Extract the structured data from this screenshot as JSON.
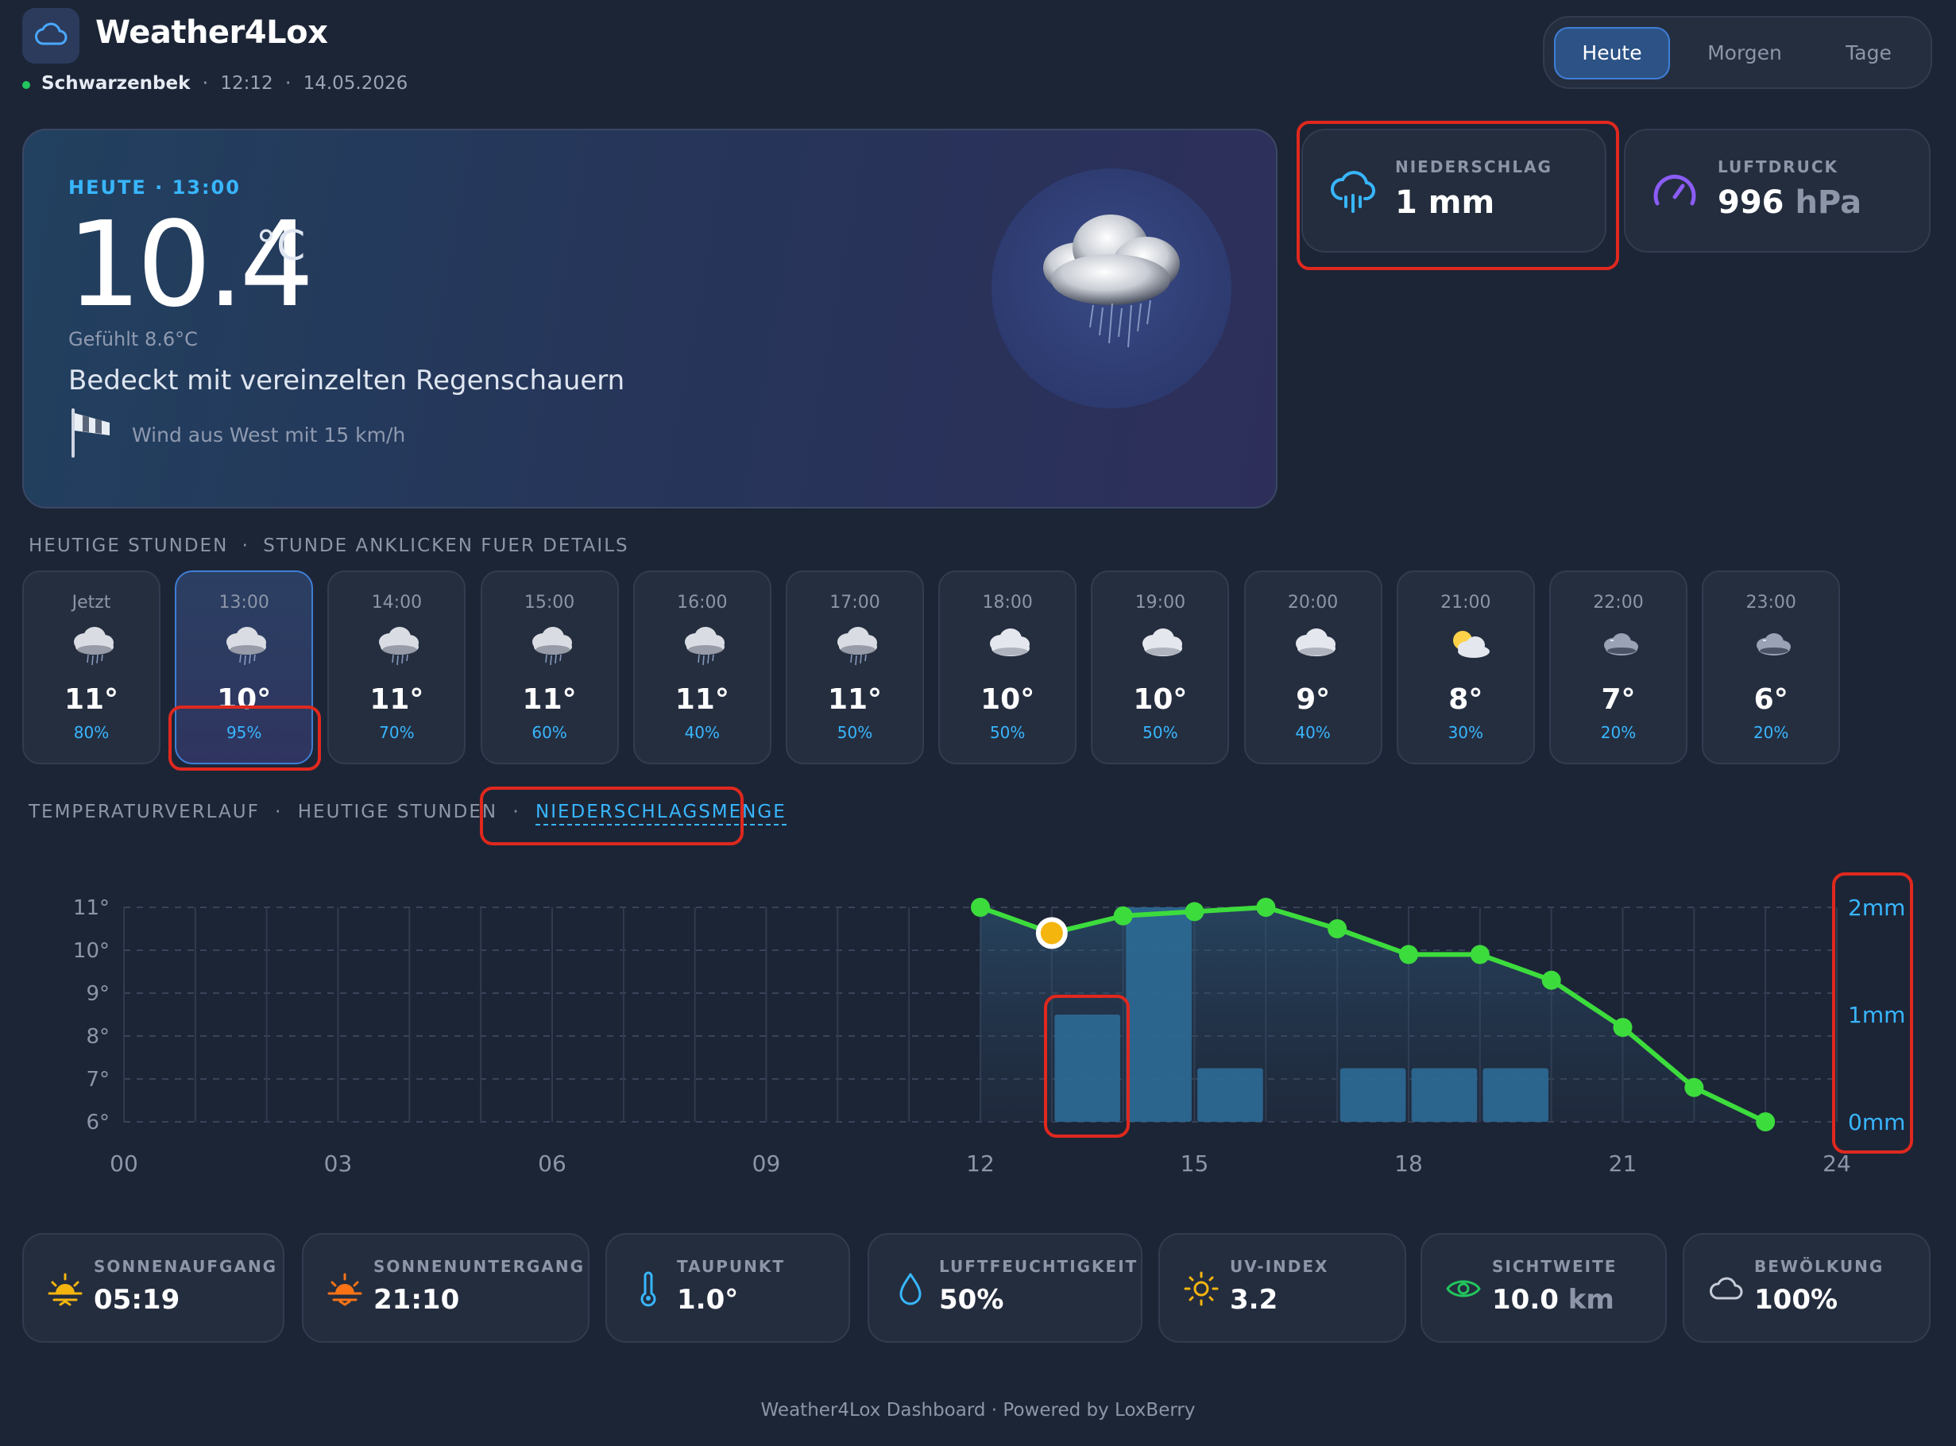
{
  "app": {
    "title": "Weather4Lox",
    "location": "Schwarzenbek",
    "time": "12:12",
    "date": "14.05.2026",
    "separator": "·"
  },
  "tabs": [
    {
      "label": "Heute",
      "active": true
    },
    {
      "label": "Morgen",
      "active": false
    },
    {
      "label": "Tage",
      "active": false
    }
  ],
  "hero": {
    "label": "HEUTE · 13:00",
    "temperature": "10.4",
    "unit": "°C",
    "feels_like": "Gefühlt 8.6°C",
    "description": "Bedeckt mit vereinzelten Regenschauern",
    "wind": "Wind aus West mit 15 km/h",
    "icon": "cloud-rain-icon"
  },
  "stats": {
    "precipitation": {
      "label": "NIEDERSCHLAG",
      "value": "1 mm",
      "icon": "rain-cloud-icon"
    },
    "pressure": {
      "label": "LUFTDRUCK",
      "value": "996",
      "unit": "hPa",
      "icon": "gauge-icon"
    }
  },
  "hourly_header": {
    "left": "HEUTIGE STUNDEN",
    "sep": "·",
    "right": "STUNDE ANKLICKEN FUER DETAILS"
  },
  "hours": [
    {
      "time": "Jetzt",
      "temp": "11°",
      "precip": "80%",
      "icon": "rain-cloud-icon"
    },
    {
      "time": "13:00",
      "temp": "10°",
      "precip": "95%",
      "icon": "rain-cloud-icon",
      "selected": true
    },
    {
      "time": "14:00",
      "temp": "11°",
      "precip": "70%",
      "icon": "rain-cloud-icon"
    },
    {
      "time": "15:00",
      "temp": "11°",
      "precip": "60%",
      "icon": "rain-cloud-icon"
    },
    {
      "time": "16:00",
      "temp": "11°",
      "precip": "40%",
      "icon": "rain-cloud-icon"
    },
    {
      "time": "17:00",
      "temp": "11°",
      "precip": "50%",
      "icon": "rain-cloud-icon"
    },
    {
      "time": "18:00",
      "temp": "10°",
      "precip": "50%",
      "icon": "cloud-icon"
    },
    {
      "time": "19:00",
      "temp": "10°",
      "precip": "50%",
      "icon": "cloud-icon"
    },
    {
      "time": "20:00",
      "temp": "9°",
      "precip": "40%",
      "icon": "cloud-icon"
    },
    {
      "time": "21:00",
      "temp": "8°",
      "precip": "30%",
      "icon": "partly-cloudy-icon"
    },
    {
      "time": "22:00",
      "temp": "7°",
      "precip": "20%",
      "icon": "cloudy-night-icon"
    },
    {
      "time": "23:00",
      "temp": "6°",
      "precip": "20%",
      "icon": "cloudy-night-icon"
    }
  ],
  "chart_header": {
    "tab1": "TEMPERATURVERLAUF",
    "sep": "·",
    "tab2": "HEUTIGE STUNDEN",
    "tab3": "NIEDERSCHLAGSMENGE"
  },
  "chart_data": {
    "type": "line",
    "x_ticks": [
      "00",
      "03",
      "06",
      "09",
      "12",
      "15",
      "18",
      "21",
      "24"
    ],
    "y_ticks": [
      "11°",
      "10°",
      "9°",
      "8°",
      "7°",
      "6°"
    ],
    "y2_ticks": [
      "2mm",
      "1mm",
      "0mm"
    ],
    "xlim": [
      0,
      24
    ],
    "ylim": [
      6,
      11
    ],
    "y2lim": [
      0,
      2
    ],
    "grid": true,
    "series": [
      {
        "type": "line",
        "x": [
          12,
          13,
          14,
          15,
          16,
          17,
          18,
          19,
          20,
          21,
          22,
          23
        ],
        "values": [
          11,
          10.4,
          10.8,
          10.9,
          11,
          10.5,
          9.9,
          9.9,
          9.3,
          8.2,
          6.8,
          6.0
        ],
        "color": "#3ddc3d",
        "highlight_x": 13,
        "highlight_color": "#f5b50f"
      },
      {
        "type": "bar",
        "x": [
          13,
          14,
          15,
          17,
          18,
          19
        ],
        "values": [
          1.0,
          2.0,
          0.5,
          0.5,
          0.5,
          0.5
        ],
        "color": "#2c6a95"
      }
    ]
  },
  "bottom": [
    {
      "label": "SONNENAUFGANG",
      "value": "05:19",
      "unit": "",
      "icon": "sunrise-icon"
    },
    {
      "label": "SONNENUNTERGANG",
      "value": "21:10",
      "unit": "",
      "icon": "sunset-icon"
    },
    {
      "label": "TAUPUNKT",
      "value": "1.0°",
      "unit": "",
      "icon": "thermometer-icon"
    },
    {
      "label": "LUFTFEUCHTIGKEIT",
      "value": "50%",
      "unit": "",
      "icon": "droplet-icon"
    },
    {
      "label": "UV-INDEX",
      "value": "3.2",
      "unit": "",
      "icon": "sun-icon"
    },
    {
      "label": "SICHTWEITE",
      "value": "10.0",
      "unit": "km",
      "icon": "eye-icon"
    },
    {
      "label": "BEWÖLKUNG",
      "value": "100%",
      "unit": "",
      "icon": "cloud-outline-icon"
    }
  ],
  "footer": "Weather4Lox Dashboard · Powered by LoxBerry",
  "colors": {
    "background": "#1c2536",
    "accent": "#38b6ff",
    "line": "#3ddc3d",
    "highlight": "#e0281e"
  }
}
